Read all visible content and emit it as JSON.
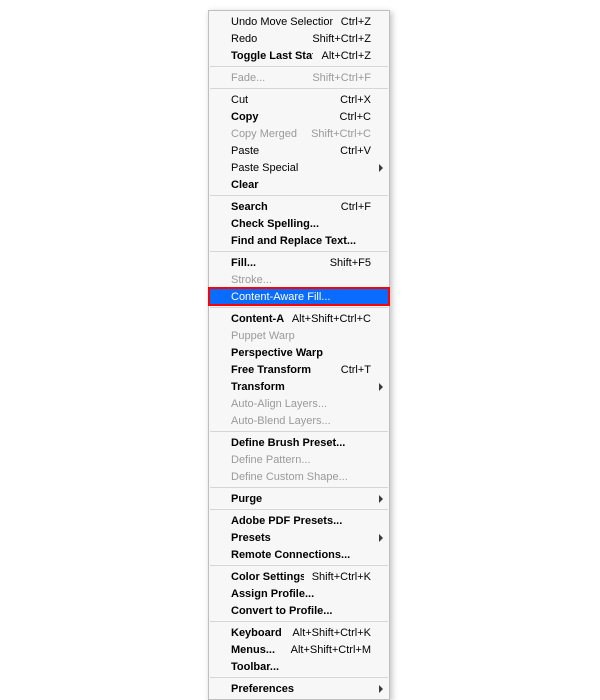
{
  "menu": {
    "groups": [
      [
        {
          "id": "undo-move-selection",
          "label": "Undo Move Selection",
          "shortcut": "Ctrl+Z"
        },
        {
          "id": "redo",
          "label": "Redo",
          "shortcut": "Shift+Ctrl+Z"
        },
        {
          "id": "toggle-last-state",
          "label": "Toggle Last State",
          "shortcut": "Alt+Ctrl+Z",
          "bold": true
        }
      ],
      [
        {
          "id": "fade",
          "label": "Fade...",
          "shortcut": "Shift+Ctrl+F",
          "disabled": true
        }
      ],
      [
        {
          "id": "cut",
          "label": "Cut",
          "shortcut": "Ctrl+X"
        },
        {
          "id": "copy",
          "label": "Copy",
          "shortcut": "Ctrl+C",
          "bold": true
        },
        {
          "id": "copy-merged",
          "label": "Copy Merged",
          "shortcut": "Shift+Ctrl+C",
          "disabled": true
        },
        {
          "id": "paste",
          "label": "Paste",
          "shortcut": "Ctrl+V"
        },
        {
          "id": "paste-special",
          "label": "Paste Special",
          "submenu": true
        },
        {
          "id": "clear",
          "label": "Clear",
          "bold": true
        }
      ],
      [
        {
          "id": "search",
          "label": "Search",
          "shortcut": "Ctrl+F",
          "bold": true
        },
        {
          "id": "check-spelling",
          "label": "Check Spelling...",
          "bold": true
        },
        {
          "id": "find-replace",
          "label": "Find and Replace Text...",
          "bold": true
        }
      ],
      [
        {
          "id": "fill",
          "label": "Fill...",
          "shortcut": "Shift+F5",
          "bold": true
        },
        {
          "id": "stroke",
          "label": "Stroke...",
          "disabled": true
        },
        {
          "id": "content-aware-fill",
          "label": "Content-Aware Fill...",
          "highlight": true,
          "boxed": true
        }
      ],
      [
        {
          "id": "content-aware-scale",
          "label": "Content-Aware Scale",
          "shortcut": "Alt+Shift+Ctrl+C",
          "bold": true
        },
        {
          "id": "puppet-warp",
          "label": "Puppet Warp",
          "disabled": true
        },
        {
          "id": "perspective-warp",
          "label": "Perspective Warp",
          "bold": true
        },
        {
          "id": "free-transform",
          "label": "Free Transform",
          "shortcut": "Ctrl+T",
          "bold": true
        },
        {
          "id": "transform",
          "label": "Transform",
          "submenu": true,
          "bold": true
        },
        {
          "id": "auto-align",
          "label": "Auto-Align Layers...",
          "disabled": true
        },
        {
          "id": "auto-blend",
          "label": "Auto-Blend Layers...",
          "disabled": true
        }
      ],
      [
        {
          "id": "define-brush",
          "label": "Define Brush Preset...",
          "bold": true
        },
        {
          "id": "define-pattern",
          "label": "Define Pattern...",
          "disabled": true
        },
        {
          "id": "define-custom-shape",
          "label": "Define Custom Shape...",
          "disabled": true
        }
      ],
      [
        {
          "id": "purge",
          "label": "Purge",
          "submenu": true,
          "bold": true
        }
      ],
      [
        {
          "id": "adobe-pdf-presets",
          "label": "Adobe PDF Presets...",
          "bold": true
        },
        {
          "id": "presets",
          "label": "Presets",
          "submenu": true,
          "bold": true
        },
        {
          "id": "remote-connections",
          "label": "Remote Connections...",
          "bold": true
        }
      ],
      [
        {
          "id": "color-settings",
          "label": "Color Settings...",
          "shortcut": "Shift+Ctrl+K",
          "bold": true
        },
        {
          "id": "assign-profile",
          "label": "Assign Profile...",
          "bold": true
        },
        {
          "id": "convert-to-profile",
          "label": "Convert to Profile...",
          "bold": true
        }
      ],
      [
        {
          "id": "keyboard-shortcuts",
          "label": "Keyboard Shortcuts...",
          "shortcut": "Alt+Shift+Ctrl+K",
          "bold": true
        },
        {
          "id": "menus",
          "label": "Menus...",
          "shortcut": "Alt+Shift+Ctrl+M",
          "bold": true
        },
        {
          "id": "toolbar",
          "label": "Toolbar...",
          "bold": true
        }
      ],
      [
        {
          "id": "preferences",
          "label": "Preferences",
          "submenu": true,
          "bold": true
        }
      ]
    ]
  }
}
